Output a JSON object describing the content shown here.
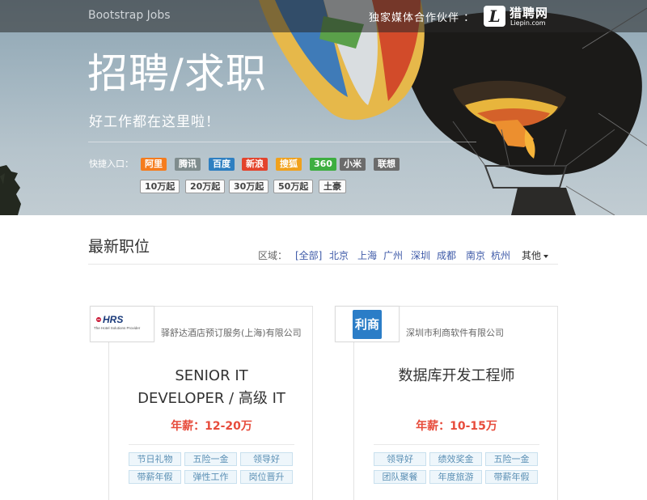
{
  "header": {
    "brand": "Bootstrap Jobs",
    "partner_label": "独家媒体合作伙伴 ：",
    "partner_logo": {
      "mark": "L",
      "name_cn": "猎聘网",
      "name_en": "Liepin.com"
    }
  },
  "hero": {
    "title": "招聘/求职",
    "subtitle": "好工作都在这里啦！",
    "quick_label": "快捷入口：",
    "company_chips": [
      {
        "label": "阿里",
        "color": "#f57c1e"
      },
      {
        "label": "腾讯",
        "color": "#7f8c8d"
      },
      {
        "label": "百度",
        "color": "#2e7fc1"
      },
      {
        "label": "新浪",
        "color": "#e3432c"
      },
      {
        "label": "搜狐",
        "color": "#f0a11c"
      },
      {
        "label": "360",
        "color": "#3dae40"
      },
      {
        "label": "小米",
        "color": "#6b6b6b"
      },
      {
        "label": "联想",
        "color": "#6b6b6b"
      }
    ],
    "salary_chips": [
      "10万起",
      "20万起",
      "30万起",
      "50万起",
      "土豪"
    ]
  },
  "latest": {
    "title": "最新职位",
    "region_label": "区域：",
    "regions": [
      "[全部]",
      "北京",
      "上海",
      "广州",
      "深圳",
      "成都",
      "南京",
      "杭州"
    ],
    "more_label": "其他"
  },
  "jobs": [
    {
      "company": "驿舒达酒店预订服务(上海)有限公司",
      "logo": {
        "text": "HRS",
        "tagline": "The Hotel Solutions Provider",
        "color": "#c8102e"
      },
      "title_lines": [
        "SENIOR IT",
        "DEVELOPER / 高级 IT"
      ],
      "salary": "年薪：12-20万",
      "tags": [
        "节日礼物",
        "五险一金",
        "领导好",
        "带薪年假",
        "弹性工作",
        "岗位晋升"
      ]
    },
    {
      "company": "深圳市利商软件有限公司",
      "logo": {
        "text": "利商",
        "color": "#2b7dc7"
      },
      "title_lines": [
        "数据库开发工程师"
      ],
      "salary": "年薪：10-15万",
      "tags": [
        "领导好",
        "绩效奖金",
        "五险一金",
        "团队聚餐",
        "年度旅游",
        "带薪年假"
      ]
    }
  ],
  "colors": {
    "accent_red": "#e74c3c",
    "link_blue": "#3e5aa8",
    "tag_text": "#5a8fb4",
    "tag_bg": "#eef6fb"
  }
}
